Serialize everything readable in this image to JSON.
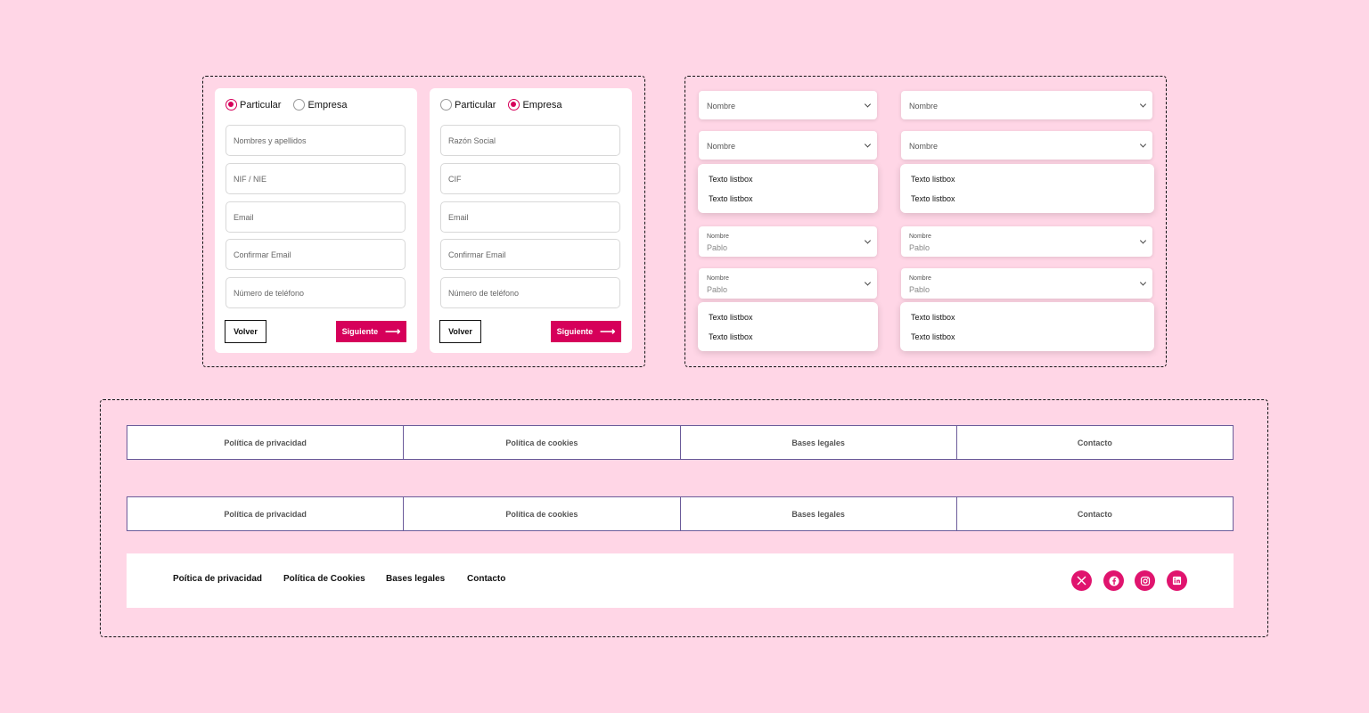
{
  "colors": {
    "accent": "#d6005a",
    "background": "#ffd6e6",
    "nav_border": "#6b5b9a"
  },
  "forms": [
    {
      "radios": [
        {
          "label": "Particular",
          "checked": true
        },
        {
          "label": "Empresa",
          "checked": false
        }
      ],
      "fields": [
        "Nombres y apellidos",
        "NIF / NIE",
        "Email",
        "Confirmar Email",
        "Número de teléfono"
      ],
      "back": "Volver",
      "next": "Siguiente"
    },
    {
      "radios": [
        {
          "label": "Particular",
          "checked": false
        },
        {
          "label": "Empresa",
          "checked": true
        }
      ],
      "fields": [
        "Razón Social",
        "CIF",
        "Email",
        "Confirmar Email",
        "Número de teléfono"
      ],
      "back": "Volver",
      "next": "Siguiente"
    }
  ],
  "selects": {
    "placeholder": "Nombre",
    "filled_label": "Nombre",
    "filled_value": "Pablo",
    "option": "Texto listbox"
  },
  "nav": [
    "Política de privacidad",
    "Política de cookies",
    "Bases legales",
    "Contacto"
  ],
  "footer": {
    "links": [
      "Poítica de privacidad",
      "Política de Cookies",
      "Bases legales",
      "Contacto"
    ],
    "icons": [
      "x-icon",
      "facebook-icon",
      "instagram-icon",
      "linkedin-icon"
    ]
  }
}
